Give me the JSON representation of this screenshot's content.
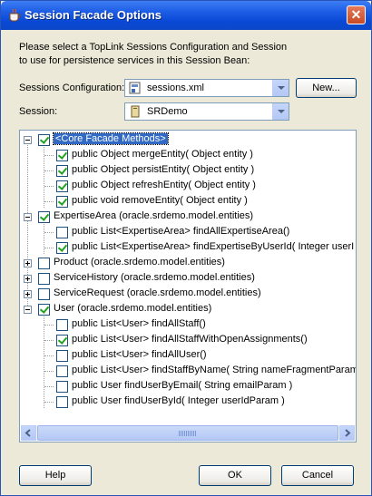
{
  "window": {
    "title": "Session Facade Options"
  },
  "instruction": "Please select a TopLink Sessions Configuration and Session to use for persistence services in this Session Bean:",
  "sessions_configuration": {
    "label": "Sessions Configuration:",
    "value": "sessions.xml"
  },
  "session": {
    "label": "Session:",
    "value": "SRDemo"
  },
  "new_button": "New...",
  "tree": {
    "rows": [
      {
        "text": "<Core Facade Methods>",
        "checked": true
      },
      {
        "text": "public Object mergeEntity( Object entity )",
        "checked": true
      },
      {
        "text": "public Object persistEntity( Object entity )",
        "checked": true
      },
      {
        "text": "public Object refreshEntity( Object entity )",
        "checked": true
      },
      {
        "text": "public void removeEntity( Object entity )",
        "checked": true
      },
      {
        "text": "ExpertiseArea (oracle.srdemo.model.entities)",
        "checked": true
      },
      {
        "text": "public List<ExpertiseArea> findAllExpertiseArea()",
        "checked": false
      },
      {
        "text": "public List<ExpertiseArea> findExpertiseByUserId( Integer userI",
        "checked": true
      },
      {
        "text": "Product (oracle.srdemo.model.entities)",
        "checked": false
      },
      {
        "text": "ServiceHistory (oracle.srdemo.model.entities)",
        "checked": false
      },
      {
        "text": "ServiceRequest (oracle.srdemo.model.entities)",
        "checked": false
      },
      {
        "text": "User (oracle.srdemo.model.entities)",
        "checked": true
      },
      {
        "text": "public List<User> findAllStaff()",
        "checked": false
      },
      {
        "text": "public List<User> findAllStaffWithOpenAssignments()",
        "checked": true
      },
      {
        "text": "public List<User> findAllUser()",
        "checked": false
      },
      {
        "text": "public List<User> findStaffByName( String nameFragmentParam",
        "checked": false
      },
      {
        "text": "public User findUserByEmail( String emailParam )",
        "checked": false
      },
      {
        "text": "public User findUserById( Integer userIdParam )",
        "checked": false
      }
    ]
  },
  "buttons": {
    "help": "Help",
    "ok": "OK",
    "cancel": "Cancel"
  }
}
